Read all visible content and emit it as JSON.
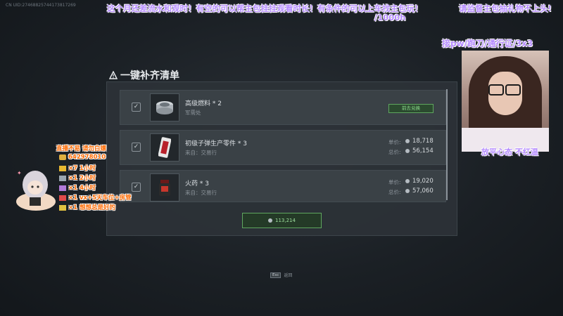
{
  "stream": {
    "uid": "CN UID:27468825744173817269",
    "banner_line1": "这个月还差流水和观时！有空的可以帮主包挂挂观看时长！有条件的可以上车找主包玩！",
    "banner_line1b": "/1000h",
    "banner_right": "请监督主包抽礼物不上头!",
    "cam_caption_top": "接pw/跑刀/通行证/3x3",
    "cam_caption_bottom": "放平心态 不红温"
  },
  "dialog": {
    "title": "一键补齐清单",
    "items": [
      {
        "name": "高级燃料 * 2",
        "source": "军需处",
        "button": "前去兑换"
      },
      {
        "name": "初级子弹生产零件 * 3",
        "source": "来自：交易行",
        "unit_label": "单价:",
        "unit_price": "18,718",
        "total_label": "总价:",
        "total_price": "56,154"
      },
      {
        "name": "火药 * 3",
        "source": "来自：交易行",
        "unit_label": "单价:",
        "unit_price": "19,020",
        "total_label": "总价:",
        "total_price": "57,060"
      }
    ],
    "total": "113,214",
    "esc_key": "Esc",
    "esc_label": "返回"
  },
  "gifts": {
    "header": "直播不易 请勿白嫖",
    "id": "642978010",
    "lines": [
      "×7  1小时",
      "×1  2小时",
      "×1  4小时",
      "×1  vx+5天车位+房管",
      "×1  想想总是好的"
    ]
  },
  "colors": {
    "accent_green": "#5fa65f",
    "banner_purple": "#b58cff",
    "gift_orange": "#ff6a00"
  }
}
